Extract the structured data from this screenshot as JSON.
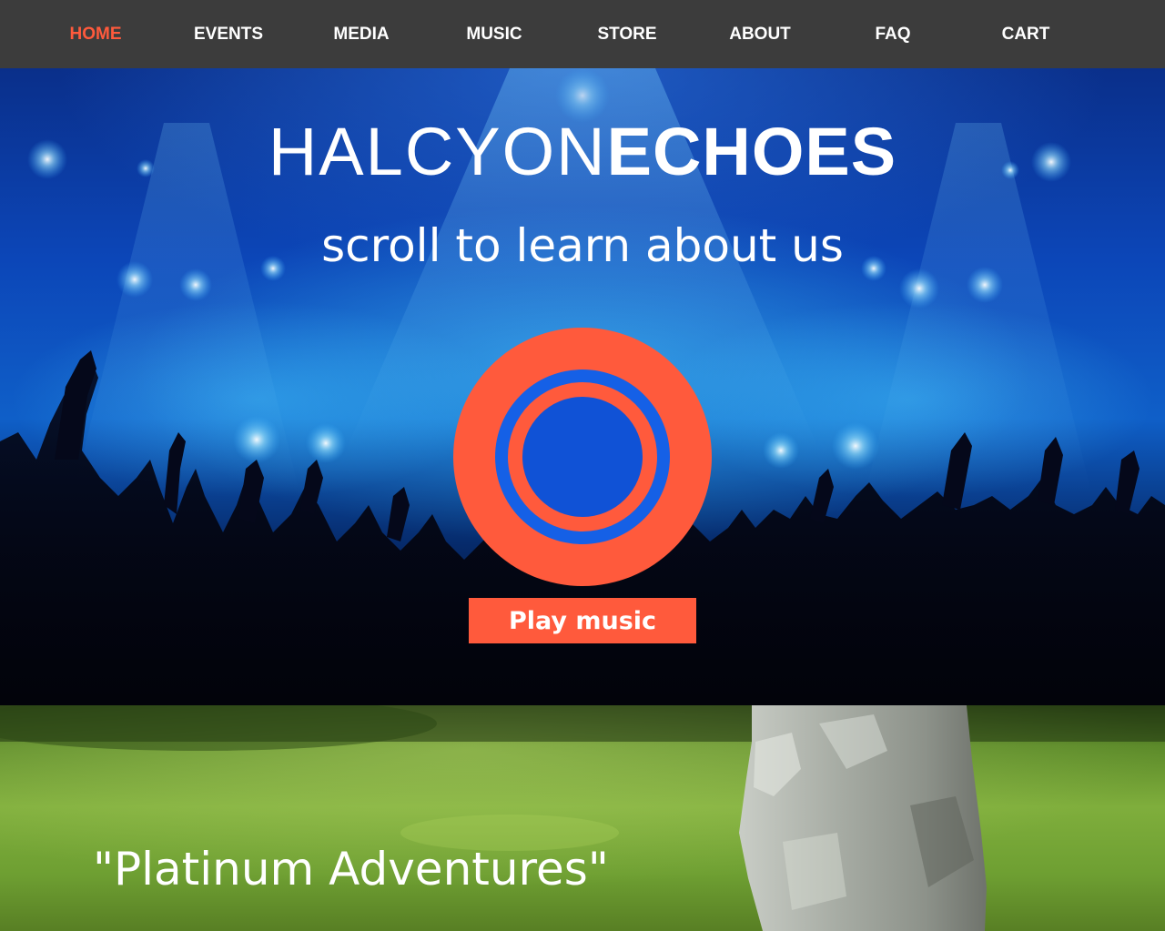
{
  "nav": {
    "items": [
      {
        "label": "HOME",
        "active": true
      },
      {
        "label": "EVENTS",
        "active": false
      },
      {
        "label": "MEDIA",
        "active": false
      },
      {
        "label": "MUSIC",
        "active": false
      },
      {
        "label": "STORE",
        "active": false
      },
      {
        "label": "ABOUT",
        "active": false
      },
      {
        "label": "FAQ",
        "active": false
      },
      {
        "label": "CART",
        "active": false
      }
    ]
  },
  "hero": {
    "brand_light": "HALCYON",
    "brand_bold": "ECHOES",
    "tagline": "scroll to learn about us",
    "play_label": "Play music",
    "play_icon": "play-ring-icon"
  },
  "section2": {
    "album_title": "\"Platinum Adventures\""
  },
  "colors": {
    "nav_bg": "#3c3c3c",
    "accent": "#ff5a3c",
    "text": "#ffffff"
  }
}
